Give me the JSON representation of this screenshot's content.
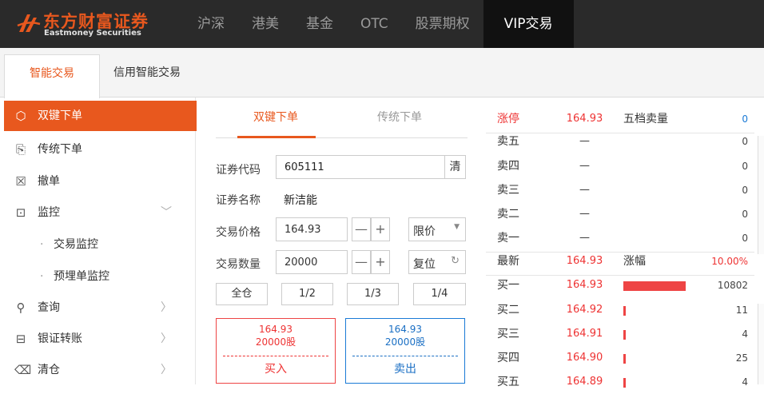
{
  "brand": {
    "name_cn": "东方财富证券",
    "name_en": "Eastmoney Securities",
    "accent": "#e8581e"
  },
  "nav": {
    "items": [
      "沪深",
      "港美",
      "基金",
      "OTC",
      "股票期权",
      "VIP交易"
    ],
    "active": "VIP交易"
  },
  "subtabs": {
    "items": [
      "智能交易",
      "信用智能交易"
    ],
    "active": "智能交易"
  },
  "sidebar": {
    "items": [
      {
        "label": "双键下单",
        "icon": "cube-icon",
        "active": true
      },
      {
        "label": "传统下单",
        "icon": "order-icon"
      },
      {
        "label": "撤单",
        "icon": "cancel-box-icon"
      },
      {
        "label": "监控",
        "icon": "monitor-icon",
        "expandable": true
      },
      {
        "label": "交易监控",
        "sub": true
      },
      {
        "label": "预埋单监控",
        "sub": true
      },
      {
        "label": "查询",
        "icon": "search-icon",
        "arrow": true
      },
      {
        "label": "银证转账",
        "icon": "transfer-icon",
        "arrow": true
      },
      {
        "label": "清仓",
        "icon": "clear-icon",
        "arrow": true
      }
    ]
  },
  "form": {
    "tabs": [
      "双键下单",
      "传统下单"
    ],
    "code_label": "证券代码",
    "code_value": "605111",
    "clear_label": "清",
    "name_label": "证券名称",
    "name_value": "新洁能",
    "price_label": "交易价格",
    "price_value": "164.93",
    "price_type": "限价",
    "qty_label": "交易数量",
    "qty_value": "20000",
    "reset_label": "复位",
    "minus": "—",
    "plus": "+",
    "portion_buttons": [
      "全仓",
      "1/2",
      "1/3",
      "1/4"
    ],
    "buy": {
      "price": "164.93",
      "qty": "20000股",
      "action": "买入"
    },
    "sell": {
      "price": "164.93",
      "qty": "20000股",
      "action": "卖出"
    }
  },
  "book": {
    "limit_up_label": "涨停",
    "limit_up_value": "164.93",
    "five_sell_label": "五档卖量",
    "five_sell_value": "0",
    "asks": [
      {
        "label": "卖五",
        "price": "—",
        "vol": "0"
      },
      {
        "label": "卖四",
        "price": "—",
        "vol": "0"
      },
      {
        "label": "卖三",
        "price": "—",
        "vol": "0"
      },
      {
        "label": "卖二",
        "price": "—",
        "vol": "0"
      },
      {
        "label": "卖一",
        "price": "—",
        "vol": "0"
      }
    ],
    "last_label": "最新",
    "last_value": "164.93",
    "chg_label": "涨幅",
    "chg_value": "10.00%",
    "bids": [
      {
        "label": "买一",
        "price": "164.93",
        "vol": "10802",
        "bar_fraction": 1.0
      },
      {
        "label": "买二",
        "price": "164.92",
        "vol": "11",
        "bar_fraction": 0.02
      },
      {
        "label": "买三",
        "price": "164.91",
        "vol": "4",
        "bar_fraction": 0.02
      },
      {
        "label": "买四",
        "price": "164.90",
        "vol": "25",
        "bar_fraction": 0.02
      },
      {
        "label": "买五",
        "price": "164.89",
        "vol": "4",
        "bar_fraction": 0.02
      }
    ]
  }
}
